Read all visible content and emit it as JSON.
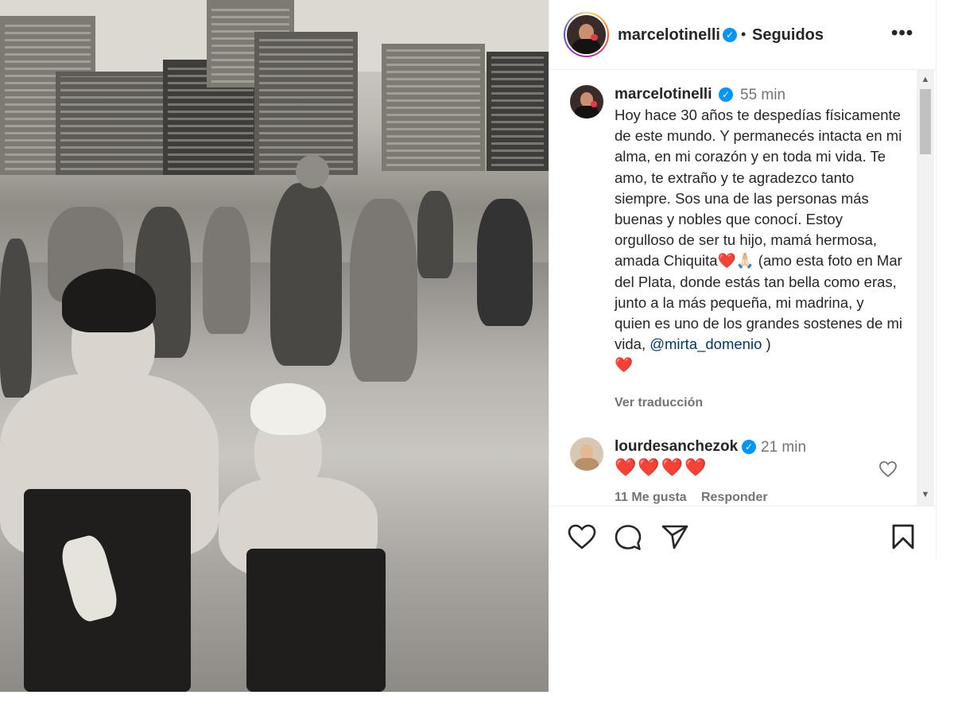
{
  "photo": {
    "alt_icon": "beach-photo"
  },
  "header": {
    "username": "marcelotinelli",
    "separator": "•",
    "follow_status": "Seguidos",
    "more_icon": "more-icon",
    "more_label": "•••"
  },
  "post": {
    "username": "marcelotinelli",
    "time": "55 min",
    "caption_before_mention": "Hoy hace 30 años te despedías físicamente de este mundo. Y permanecés intacta en mi alma, en mi corazón y en toda mi vida. Te amo, te extraño y te agradezco tanto siempre. Sos una de las personas más buenas y nobles que conocí. Estoy orgulloso de ser tu hijo, mamá hermosa, amada Chiquita",
    "caption_emojis": "❤️🙏🏻",
    "caption_mid": " (amo esta foto en Mar del Plata, donde estás tan bella como eras, junto a la más pequeña, mi madrina, y quien es uno de los grandes sostenes de mi vida, ",
    "mention": "@mirta_domenio",
    "caption_end": " )",
    "caption_heart": "❤️",
    "translate": "Ver traducción"
  },
  "comment": {
    "username": "lourdesanchezok",
    "time": "21 min",
    "text": "❤️❤️❤️❤️",
    "likes": "11 Me gusta",
    "reply": "Responder"
  },
  "actions": {
    "like_icon": "heart-icon",
    "comment_icon": "comment-icon",
    "share_icon": "send-icon",
    "save_icon": "bookmark-icon"
  },
  "colors": {
    "text": "#262626",
    "muted": "#737373",
    "verified": "#0095f6",
    "mention": "#00376b",
    "heart": "#e0192d"
  }
}
